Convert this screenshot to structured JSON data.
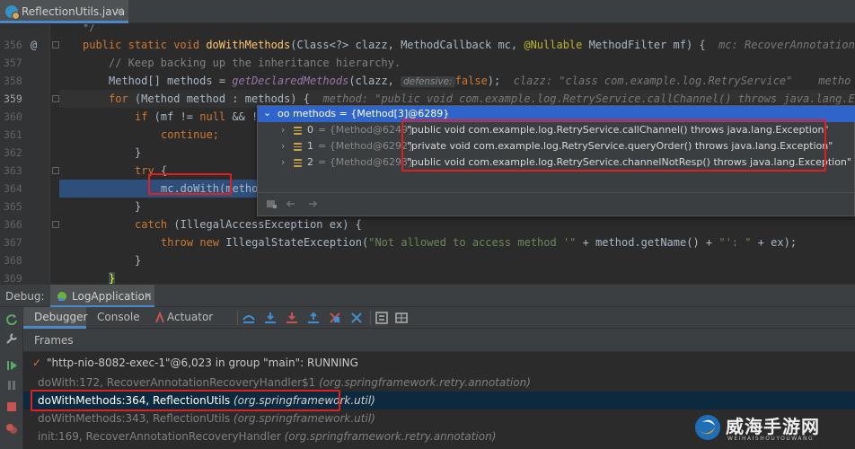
{
  "tabbar": {
    "file_tab": "ReflectionUtils.java",
    "close_glyph": "×"
  },
  "editor": {
    "lines": [
      {
        "num": "",
        "code": "*/"
      },
      {
        "num": "356",
        "marker": "@"
      },
      {
        "num": "357",
        "code": "// Keep backing up the inheritance hierarchy."
      },
      {
        "num": "358"
      },
      {
        "num": "359"
      },
      {
        "num": "360"
      },
      {
        "num": "361",
        "code": "continue;"
      },
      {
        "num": "362",
        "code": "}"
      },
      {
        "num": "363"
      },
      {
        "num": "364"
      },
      {
        "num": "365",
        "code": "}"
      },
      {
        "num": "366"
      },
      {
        "num": "367"
      },
      {
        "num": "368",
        "code": "}"
      },
      {
        "num": "369",
        "code": "}"
      }
    ],
    "l356": {
      "public": "public",
      "static": "static",
      "void": "void",
      "name": "doWithMethods",
      "args": "(Class<?> clazz, MethodCallback mc, ",
      "anno": "@Nullable",
      "args2": " MethodFilter mf) {",
      "hint": "mc: RecoverAnnotation"
    },
    "l358": {
      "code": "Method[] methods = ",
      "call": "getDeclaredMethods",
      "open": "(clazz, ",
      "param": "defensive:",
      "val": "false",
      "close": ");",
      "hint": "clazz: \"class com.example.log.RetryService\"    metho"
    },
    "l359": {
      "for": "for",
      "code": " (Method method : methods) {",
      "hint": "method: \"public void com.example.log.RetryService.callChannel() throws java.lang.E"
    },
    "l360": {
      "if": "if",
      "code": " (mf != ",
      "null": "null",
      "rest": " && !"
    },
    "l363": {
      "try": "try",
      "brace": " {"
    },
    "l364": {
      "code": "mc.doWith(metho",
      "tail": "t"
    },
    "l366": {
      "catch": "catch",
      "code": " (IllegalAccessException ex) {"
    },
    "l367": {
      "throw": "throw",
      "new": "new",
      "code": " IllegalStateException(",
      "str": "\"Not allowed to access method '\"",
      "code2": " + method.getName() + ",
      "str2": "\"': \"",
      "code3": " + ex);"
    }
  },
  "popup": {
    "header": "oo methods = {Method[3]@6289}",
    "items": [
      {
        "index": "0",
        "ref": "= {Method@6249}",
        "value": "\"public void com.example.log.RetryService.callChannel() throws java.lang.Exception\""
      },
      {
        "index": "1",
        "ref": "= {Method@6292}",
        "value": "\"private void com.example.log.RetryService.queryOrder() throws java.lang.Exception\""
      },
      {
        "index": "2",
        "ref": "= {Method@6293}",
        "value": "\"public void com.example.log.RetryService.channelNotResp() throws java.lang.Exception\""
      }
    ]
  },
  "debug": {
    "label": "Debug:",
    "session": "LogApplication",
    "close_glyph": "×",
    "tabs": [
      "Debugger",
      "Console",
      "Actuator"
    ],
    "frames_label": "Frames",
    "thread": "\"http-nio-8082-exec-1\"@6,023 in group \"main\": RUNNING",
    "frames": [
      {
        "method": "doWith:172, RecoverAnnotationRecoveryHandler$1",
        "pkg": "(org.springframework.retry.annotation)",
        "selected": false
      },
      {
        "method": "doWithMethods:364, ReflectionUtils",
        "pkg": "(org.springframework.util)",
        "selected": true
      },
      {
        "method": "doWithMethods:343, ReflectionUtils",
        "pkg": "(org.springframework.util)",
        "selected": false
      },
      {
        "method": "init:169, RecoverAnnotationRecoveryHandler",
        "pkg": "(org.springframework.retry.annotation)",
        "selected": false
      }
    ]
  },
  "watermark": {
    "text": "威海手游网",
    "sub": "WEIHAISHOUYOUWANG"
  },
  "colors": {
    "accent": "#2f65ca",
    "highlight_box": "#e02020",
    "selected_frame": "#0d293e"
  }
}
